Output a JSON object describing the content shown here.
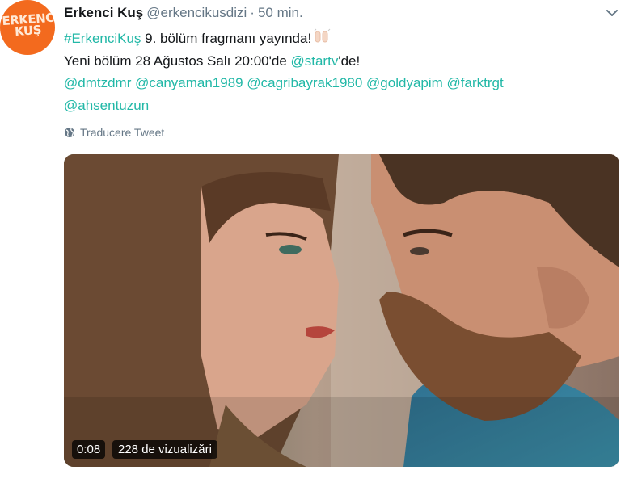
{
  "tweet": {
    "avatar_text_line1": "ERKENCİ",
    "avatar_text_line2": "KUŞ",
    "display_name": "Erkenci Kuş",
    "handle": "@erkencikusdizi",
    "separator": "·",
    "time": "50 min.",
    "line1": {
      "hashtag": "#ErkenciKuş",
      "text": " 9. bölüm fragmanı yayında!"
    },
    "line2": {
      "before": "Yeni bölüm 28 Ağustos Salı 20:00'de ",
      "mention": "@startv",
      "after": "'de!"
    },
    "mentions": [
      "@dmtzdmr",
      "@canyaman1989",
      "@cagribayrak1980",
      "@goldyapim",
      "@farktrgt",
      "@ahsentuzun"
    ],
    "translate_label": "Traducere Tweet",
    "emoji": "raising-hands-emoji"
  },
  "video": {
    "duration": "0:08",
    "views": "228 de vizualizări"
  },
  "colors": {
    "link": "#22b8a7",
    "avatar_bg": "#f36a1e",
    "muted": "#657786"
  }
}
